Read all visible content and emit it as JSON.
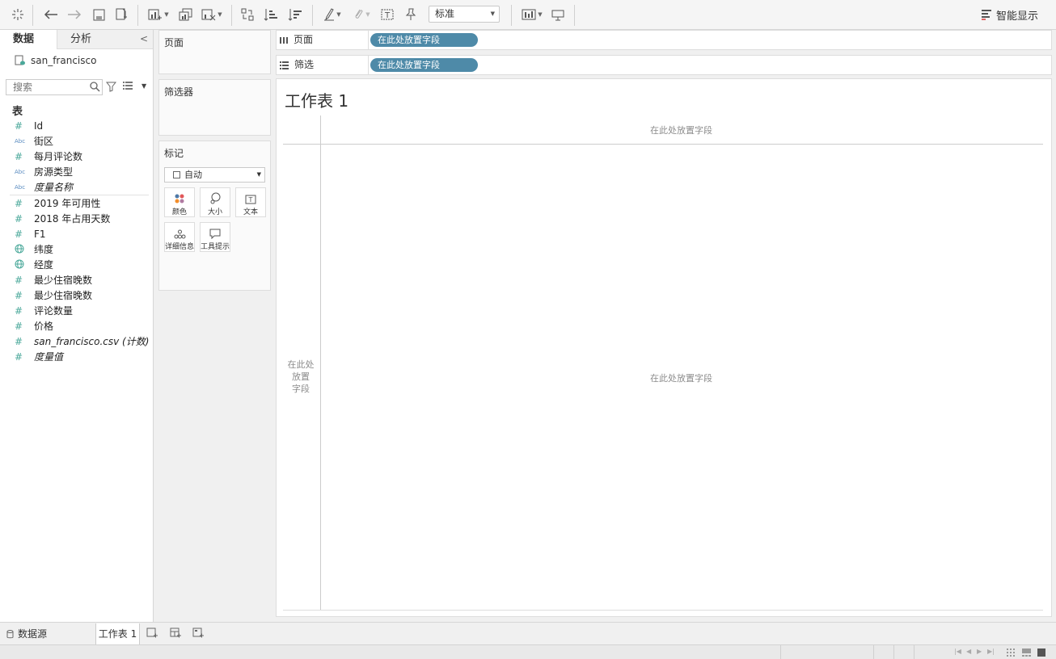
{
  "toolbar": {
    "fit_value": "标准",
    "show_me_label": "智能显示",
    "tools": [
      "tableau-logo-icon",
      "undo-icon",
      "redo-icon",
      "save-icon",
      "add-datasource-icon",
      "new-worksheet-icon",
      "duplicate-icon",
      "clear-sheet-icon",
      "swap-icon",
      "sort-ascending-icon",
      "sort-descending-icon",
      "highlight-icon",
      "annotate-icon",
      "fix-axes-icon",
      "pin-icon",
      "card-view-icon",
      "presentation-icon"
    ]
  },
  "left_panel": {
    "tab_data": "数据",
    "tab_analytics": "分析",
    "datasource_name": "san_francisco",
    "search_placeholder": "搜索",
    "tables_header": "表",
    "fields": [
      {
        "type": "#",
        "name": "Id",
        "italic": false
      },
      {
        "type": "Abc",
        "name": "街区",
        "italic": false
      },
      {
        "type": "#",
        "name": "每月评论数",
        "italic": false
      },
      {
        "type": "Abc",
        "name": "房源类型",
        "italic": false
      },
      {
        "type": "Abc",
        "name": "度量名称",
        "italic": true
      },
      {
        "type": "#",
        "name": "2019 年可用性",
        "italic": false
      },
      {
        "type": "#",
        "name": "2018 年占用天数",
        "italic": false
      },
      {
        "type": "#",
        "name": "F1",
        "italic": false
      },
      {
        "type": "globe",
        "name": "纬度",
        "italic": false
      },
      {
        "type": "globe",
        "name": "经度",
        "italic": false
      },
      {
        "type": "#",
        "name": "最少住宿晚数",
        "italic": false
      },
      {
        "type": "#",
        "name": "最少住宿晚数",
        "italic": false
      },
      {
        "type": "#",
        "name": "评论数量",
        "italic": false
      },
      {
        "type": "#",
        "name": "价格",
        "italic": false
      },
      {
        "type": "#",
        "name": "san_francisco.csv (计数)",
        "italic": true
      },
      {
        "type": "#",
        "name": "度量值",
        "italic": true
      }
    ]
  },
  "cards": {
    "pages": "页面",
    "filters": "筛选器",
    "marks": "标记",
    "marks_type": "自动",
    "mark_buttons": {
      "color": "颜色",
      "size": "大小",
      "text": "文本",
      "detail": "详细信息",
      "tooltip": "工具提示"
    }
  },
  "shelves": {
    "columns_label": "页面",
    "rows_label": "筛选",
    "drop_placeholder": "在此处放置字段"
  },
  "view": {
    "sheet_title": "工作表 1",
    "drop_cols": "在此处放置字段",
    "drop_rows": "在此处放置字段",
    "drop_body": "在此处放置字段"
  },
  "bottom": {
    "datasource_tab": "数据源",
    "sheet_tab": "工作表 1"
  }
}
